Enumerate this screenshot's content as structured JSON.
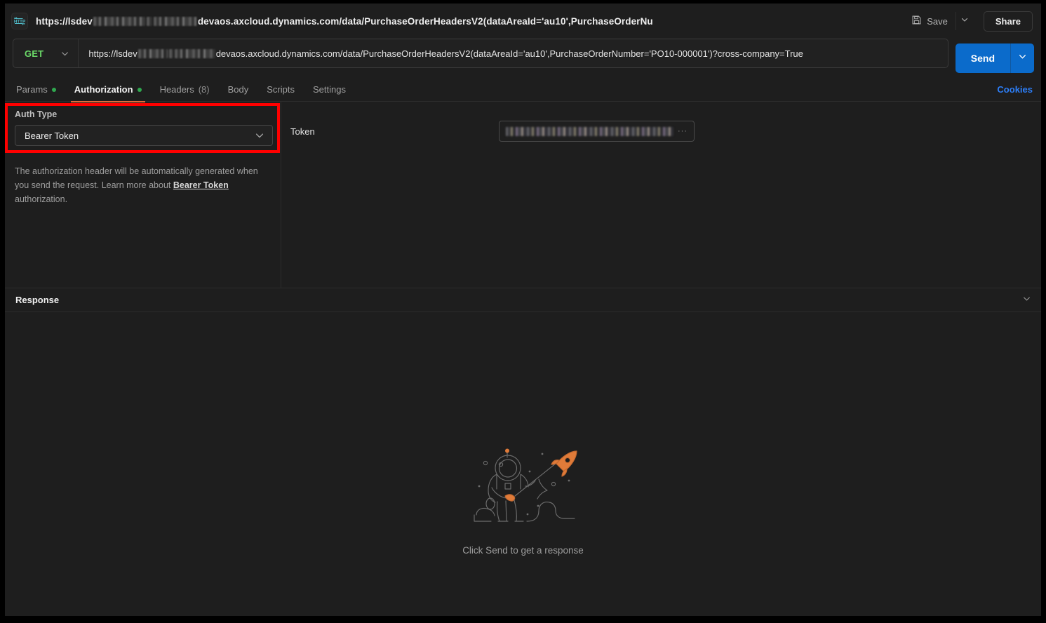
{
  "window": {
    "app": "Postman",
    "accent_color": "#0b6bcb",
    "highlight_color": "#ff0000",
    "background": "#1e1e1e"
  },
  "titlebar": {
    "protocol_icon": "http-icon",
    "request_title_prefix": "https://lsdev",
    "request_title_suffix": "devaos.axcloud.dynamics.com/data/PurchaseOrderHeadersV2(dataAreaId='au10',PurchaseOrderNu",
    "save_label": "Save",
    "save_icon": "floppy-disk-icon",
    "save_dropdown_icon": "chevron-down-icon",
    "share_label": "Share"
  },
  "urlbar": {
    "method": "GET",
    "method_caret_icon": "chevron-down-icon",
    "url_prefix": "https://lsdev",
    "url_suffix": "devaos.axcloud.dynamics.com/data/PurchaseOrderHeadersV2(dataAreaId='au10',PurchaseOrderNumber='PO10-000001')?cross-company=True",
    "send_label": "Send",
    "send_caret_icon": "chevron-down-icon"
  },
  "tabs": {
    "items": [
      {
        "label": "Params",
        "has_dot": true,
        "active": false,
        "count": ""
      },
      {
        "label": "Authorization",
        "has_dot": true,
        "active": true,
        "count": ""
      },
      {
        "label": "Headers",
        "has_dot": false,
        "active": false,
        "count": "(8)"
      },
      {
        "label": "Body",
        "has_dot": false,
        "active": false,
        "count": ""
      },
      {
        "label": "Scripts",
        "has_dot": false,
        "active": false,
        "count": ""
      },
      {
        "label": "Settings",
        "has_dot": false,
        "active": false,
        "count": ""
      }
    ],
    "cookies_label": "Cookies"
  },
  "authorization": {
    "auth_type_label": "Auth Type",
    "auth_type_value": "Bearer Token",
    "auth_type_caret_icon": "chevron-down-icon",
    "help_text_part1": "The authorization header will be automatically generated when you send the request. Learn more about ",
    "help_link": "Bearer Token",
    "help_text_part2": " authorization.",
    "token_label": "Token",
    "token_value_redacted": true,
    "token_overflow_indicator": "···"
  },
  "response": {
    "title": "Response",
    "collapse_icon": "chevron-down-icon",
    "empty_illustration": "astronaut-with-rocket-kite-icon",
    "empty_message": "Click Send to get a response"
  }
}
